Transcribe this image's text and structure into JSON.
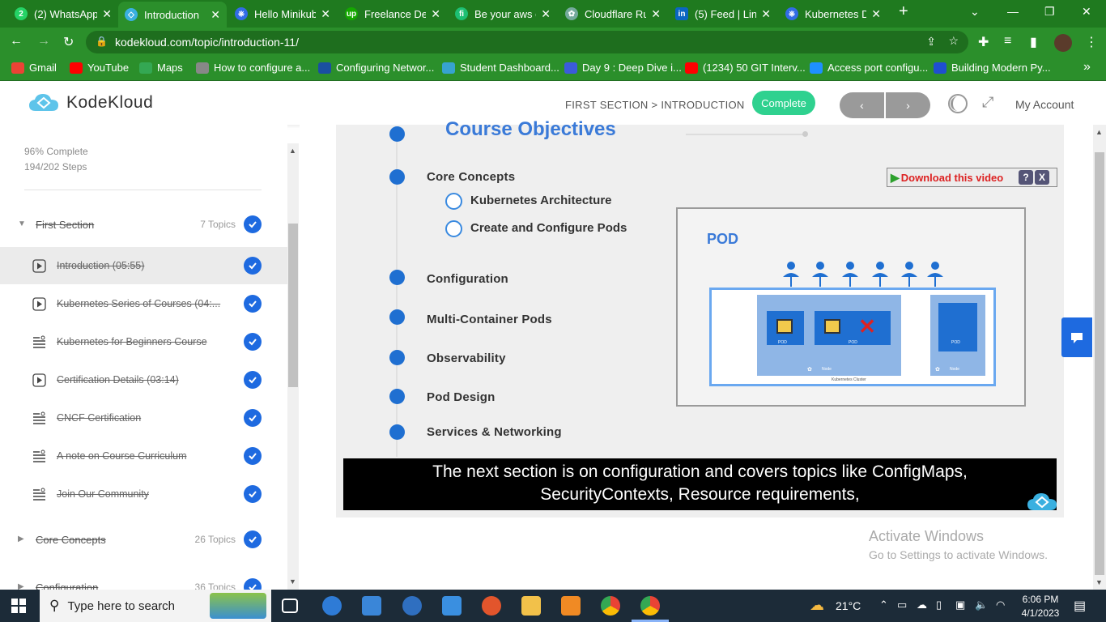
{
  "browser": {
    "tabs": [
      {
        "title": "(2) WhatsApp",
        "favicon": "whatsapp-icon",
        "color": "#25d366"
      },
      {
        "title": "Introduction",
        "favicon": "kodekloud-icon",
        "color": "#3ab0e0",
        "active": true
      },
      {
        "title": "Hello Minikub",
        "favicon": "kubernetes-icon",
        "color": "#326ce5"
      },
      {
        "title": "Freelance Dev",
        "favicon": "upwork-icon",
        "color": "#14a800"
      },
      {
        "title": "Be your aws c",
        "favicon": "fiverr-icon",
        "color": "#1dbf73"
      },
      {
        "title": "Cloudflare Ru",
        "favicon": "chatgpt-icon",
        "color": "#74aa9c"
      },
      {
        "title": "(5) Feed | Link",
        "favicon": "linkedin-icon",
        "color": "#0a66c2"
      },
      {
        "title": "Kubernetes D",
        "favicon": "kubernetes-icon",
        "color": "#326ce5"
      }
    ],
    "new_tab": "+",
    "url": "kodekloud.com/topic/introduction-11/",
    "bookmarks": [
      {
        "label": "Gmail",
        "color": "#ea4335"
      },
      {
        "label": "YouTube",
        "color": "#ff0000"
      },
      {
        "label": "Maps",
        "color": "#34a853"
      },
      {
        "label": "How to configure a...",
        "color": "#888888"
      },
      {
        "label": "Configuring Networ...",
        "color": "#1a4fa0"
      },
      {
        "label": "Student Dashboard...",
        "color": "#37a3d0"
      },
      {
        "label": "Day 9 : Deep Dive i...",
        "color": "#3b5bdb"
      },
      {
        "label": "(1234) 50 GIT Interv...",
        "color": "#ff0000"
      },
      {
        "label": "Access port configu...",
        "color": "#1e90ff"
      },
      {
        "label": "Building Modern Py...",
        "color": "#1f4fd0"
      }
    ],
    "more": "»"
  },
  "site": {
    "brand": "KodeKloud",
    "breadcrumb": "FIRST SECTION > INTRODUCTION",
    "complete_label": "Complete",
    "prev": "‹",
    "next": "›",
    "account": "My Account"
  },
  "sidebar": {
    "percent": "96% Complete",
    "steps": "194/202 Steps",
    "sections": [
      {
        "name": "First Section",
        "topics": "7 Topics",
        "expanded": true
      },
      {
        "name": "Core Concepts",
        "topics": "26 Topics",
        "expanded": false
      },
      {
        "name": "Configuration",
        "topics": "36 Topics",
        "expanded": false
      }
    ],
    "lessons": [
      {
        "name": "Introduction (05:55)",
        "type": "video",
        "active": true
      },
      {
        "name": "Kubernetes Series of Courses (04:...",
        "type": "video"
      },
      {
        "name": "Kubernetes for Beginners Course",
        "type": "text"
      },
      {
        "name": "Certification Details (03:14)",
        "type": "video"
      },
      {
        "name": "CNCF Certification",
        "type": "text"
      },
      {
        "name": "A note on Course Curriculum",
        "type": "text"
      },
      {
        "name": "Join Our Community",
        "type": "text"
      }
    ]
  },
  "video": {
    "title": "Course Objectives",
    "objectives": [
      "Core Concepts",
      "Configuration",
      "Multi-Container Pods",
      "Observability",
      "Pod Design",
      "Services & Networking"
    ],
    "sub_objectives": [
      "Kubernetes Architecture",
      "Create and Configure Pods"
    ],
    "pod_label": "POD",
    "pod_caption": "POD",
    "node_label": "Node",
    "cluster_label": "Kubernetes Cluster",
    "download": "Download this video",
    "help": "?",
    "close": "X",
    "caption_line1": "The next section is on configuration and covers topics like ConfigMaps,",
    "caption_line2": "SecurityContexts, Resource requirements,"
  },
  "watermark": {
    "line1": "Activate Windows",
    "line2": "Go to Settings to activate Windows."
  },
  "taskbar": {
    "search_placeholder": "Type here to search",
    "weather": "21°C",
    "time": "6:06 PM",
    "date": "4/1/2023"
  }
}
